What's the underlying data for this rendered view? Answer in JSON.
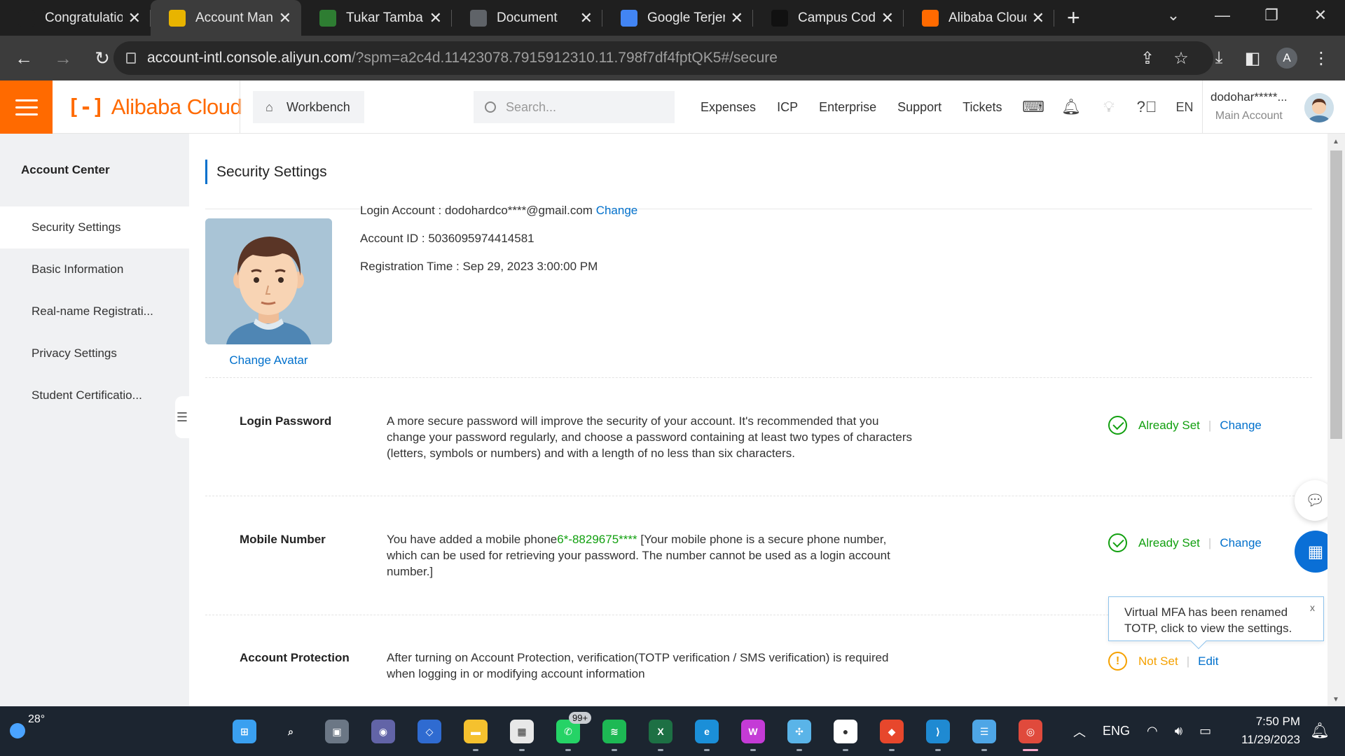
{
  "browser": {
    "tabs": [
      {
        "title": "Congratulatio",
        "icon": "gmail-icon",
        "color": "#1f1f1f"
      },
      {
        "title": "Account Mana",
        "icon": "page-icon",
        "color": "#e8b400",
        "active": true
      },
      {
        "title": "Tukar Tambah",
        "icon": "owl-icon",
        "color": "#2e7d32"
      },
      {
        "title": "Document",
        "icon": "globe-icon",
        "color": "#5f6368"
      },
      {
        "title": "Google Terjem",
        "icon": "translate-icon",
        "color": "#4285f4"
      },
      {
        "title": "Campus Code",
        "icon": "campus-icon",
        "color": "#111111"
      },
      {
        "title": "Alibaba Cloud",
        "icon": "alibaba-icon",
        "color": "#ff6a00"
      }
    ],
    "url_host": "account-intl.console.aliyun.com",
    "url_rest": "/?spm=a2c4d.11423078.7915912310.11.798f7df4fptQK5#/secure",
    "profile_letter": "A"
  },
  "header": {
    "logo_mark": "[-]",
    "logo_text": "Alibaba Cloud",
    "workbench": "Workbench",
    "search_placeholder": "Search...",
    "nav": [
      "Expenses",
      "ICP",
      "Enterprise",
      "Support",
      "Tickets"
    ],
    "lang": "EN",
    "account_name": "dodohar*****...",
    "account_role": "Main Account"
  },
  "sidebar": {
    "title": "Account Center",
    "items": [
      {
        "label": "Security Settings",
        "active": true
      },
      {
        "label": "Basic Information"
      },
      {
        "label": "Real-name Registrati..."
      },
      {
        "label": "Privacy Settings"
      },
      {
        "label": "Student Certificatio..."
      }
    ]
  },
  "main": {
    "page_title": "Security Settings",
    "change_avatar": "Change Avatar",
    "login_account_label": "Login Account : ",
    "login_account_value": "dodohardco****@gmail.com",
    "login_account_change": "Change",
    "account_id_label": "Account ID : ",
    "account_id_value": "5036095974414581",
    "registration_label": "Registration Time : ",
    "registration_value": "Sep 29, 2023 3:00:00 PM",
    "rows": [
      {
        "label": "Login Password",
        "desc": "A more secure password will improve the security of your account. It's recommended that you change your password regularly, and choose a password containing at least two types of characters (letters, symbols or numbers) and with a length of no less than six characters.",
        "status": "Already Set",
        "action": "Change"
      },
      {
        "label": "Mobile Number",
        "desc_pre": "You have added a mobile phone",
        "desc_phone": "6*-8829675****",
        "desc_post": " [Your mobile phone is a secure phone number, which can be used for retrieving your password. The number cannot be used as a login account number.]",
        "status": "Already Set",
        "action": "Change"
      },
      {
        "label": "Account Protection",
        "desc": "After turning on Account Protection, verification(TOTP verification / SMS verification) is required when logging in or modifying account information",
        "status": "Not Set",
        "action": "Edit"
      }
    ],
    "tooltip": "Virtual MFA has been renamed TOTP, click to view the settings.",
    "tooltip_close": "x"
  },
  "taskbar": {
    "temperature": "28°",
    "apps": [
      {
        "name": "windows-start-icon",
        "color": "#3aa0f0",
        "glyph": "⊞"
      },
      {
        "name": "search-icon",
        "color": "transparent",
        "glyph": "⌕"
      },
      {
        "name": "task-view-icon",
        "color": "#6b7785",
        "glyph": "▣"
      },
      {
        "name": "teams-chat-icon",
        "color": "#6264a7",
        "glyph": "◉"
      },
      {
        "name": "dev-app-icon",
        "color": "#2f6bd1",
        "glyph": "◇"
      },
      {
        "name": "file-explorer-icon",
        "color": "#f5c12e",
        "glyph": "▬"
      },
      {
        "name": "store-icon",
        "color": "#e8e8e8",
        "glyph": "▦"
      },
      {
        "name": "whatsapp-icon",
        "color": "#25d366",
        "glyph": "✆"
      },
      {
        "name": "spotify-icon",
        "color": "#1db954",
        "glyph": "≋"
      },
      {
        "name": "excel-icon",
        "color": "#1d7044",
        "glyph": "X"
      },
      {
        "name": "edge-icon",
        "color": "#1b8fd8",
        "glyph": "e"
      },
      {
        "name": "wps-icon",
        "color": "#c43bd6",
        "glyph": "W"
      },
      {
        "name": "game-icon",
        "color": "#5ab4e8",
        "glyph": "✣"
      },
      {
        "name": "media-icon",
        "color": "#ffffff",
        "glyph": "●"
      },
      {
        "name": "git-icon",
        "color": "#e7472c",
        "glyph": "◆"
      },
      {
        "name": "vscode-icon",
        "color": "#1f8ad2",
        "glyph": "⟩"
      },
      {
        "name": "notepad-icon",
        "color": "#4ea6e6",
        "glyph": "☰"
      },
      {
        "name": "chrome-icon",
        "color": "#e04a3c",
        "glyph": "◎",
        "active": true
      }
    ],
    "whatsapp_badge": "99+",
    "lang": "ENG",
    "time": "7:50 PM",
    "date": "11/29/2023"
  }
}
